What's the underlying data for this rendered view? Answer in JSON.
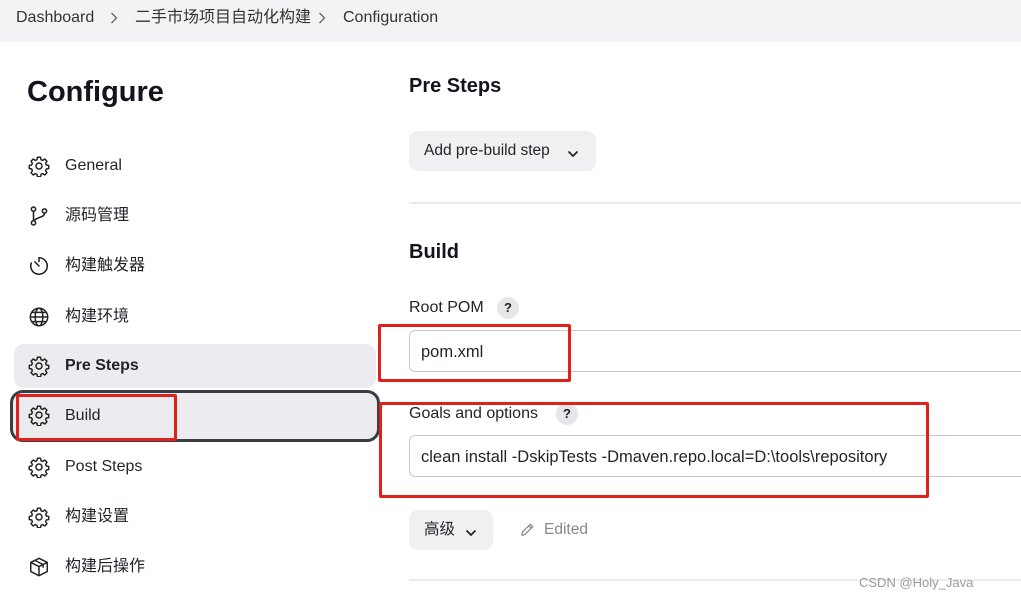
{
  "breadcrumb": {
    "items": [
      "Dashboard",
      "二手市场项目自动化构建",
      "Configuration"
    ]
  },
  "page": {
    "title": "Configure"
  },
  "sidebar": {
    "items": [
      {
        "label": "General",
        "icon": "gear-icon"
      },
      {
        "label": "源码管理",
        "icon": "branch-icon"
      },
      {
        "label": "构建触发器",
        "icon": "timer-icon"
      },
      {
        "label": "构建环境",
        "icon": "globe-icon"
      },
      {
        "label": "Pre Steps",
        "icon": "gear-icon"
      },
      {
        "label": "Build",
        "icon": "gear-icon"
      },
      {
        "label": "Post Steps",
        "icon": "gear-icon"
      },
      {
        "label": "构建设置",
        "icon": "gear-icon"
      },
      {
        "label": "构建后操作",
        "icon": "package-icon"
      }
    ],
    "active": "Pre Steps",
    "focused": "Build"
  },
  "pre_steps": {
    "title": "Pre Steps",
    "add_button": "Add pre-build step"
  },
  "build": {
    "title": "Build",
    "root_pom_label": "Root POM",
    "root_pom_value": "pom.xml",
    "goals_label": "Goals and options",
    "goals_value": "clean install -DskipTests -Dmaven.repo.local=D:\\tools\\repository",
    "help_text": "?",
    "advanced_button": "高级",
    "edited_label": "Edited"
  },
  "watermark": "CSDN @Holy_Java",
  "colors": {
    "highlight": "#e0201b",
    "active_bg": "#ececf0",
    "focus_ring": "#3b3c44"
  }
}
